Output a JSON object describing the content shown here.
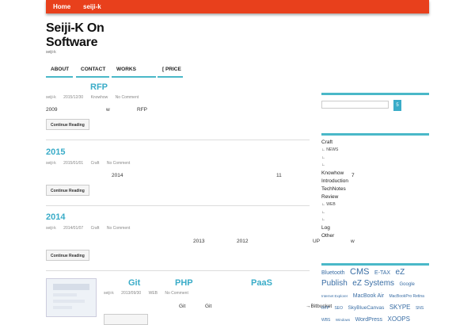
{
  "topnav": {
    "home": "Home",
    "user": "seiji-k"
  },
  "site": {
    "title": "Seiji-K On Software",
    "description": "seiji-k"
  },
  "menu": {
    "about": "ABOUT",
    "contact": "CONTACT",
    "works": "WORKS",
    "price": "[ PRICE"
  },
  "posts": [
    {
      "title": "RFP",
      "author": "seiji-k",
      "date": "2015/12/30",
      "category": "Knowhow",
      "comments": "No Comment",
      "excerpt_a": "2009",
      "excerpt_b": "w",
      "excerpt_c": "RFP",
      "button": "Continue Reading"
    },
    {
      "title": "2015",
      "author": "seiji-k",
      "date": "2015/01/01",
      "category": "Craft",
      "comments": "No Comment",
      "excerpt_a": "2014",
      "excerpt_b": "11",
      "button": "Continue Reading"
    },
    {
      "title": "2014",
      "author": "seiji-k",
      "date": "2014/01/07",
      "category": "Craft",
      "comments": "No Comment",
      "excerpt_a": "2013",
      "excerpt_b": "2012",
      "excerpt_c": "UP",
      "excerpt_d": "w",
      "button": "Continue Reading"
    },
    {
      "title_a": "Git",
      "title_b": "PHP",
      "title_c": "PaaS",
      "author": "seiji-k",
      "date": "2013/09/30",
      "category": "WEB",
      "comments": "No Comment",
      "excerpt_a": "Git",
      "excerpt_b": "Git",
      "excerpt_c": "→Bitbucket"
    }
  ],
  "sidebar": {
    "search_button": "5",
    "categories": [
      "Craft",
      "NEWS",
      "Knowhow",
      "7",
      "Introduction",
      "TechNotes",
      "Review",
      "WEB",
      "Log",
      "Other"
    ],
    "tags": [
      "Bluetooth",
      "CMS",
      "E-TAX",
      "eZ Publish",
      "eZ Systems",
      "Google",
      "Internet Explorer",
      "MacBook Air",
      "MacBookPro Retina",
      "RFP",
      "SEO",
      "SkyBlueCanvas",
      "SKYPE",
      "SNS",
      "WBS",
      "Windows",
      "WordPress",
      "XOOPS"
    ]
  },
  "colors": {
    "accent": "#3aacc8",
    "topbar": "#e8401c"
  }
}
